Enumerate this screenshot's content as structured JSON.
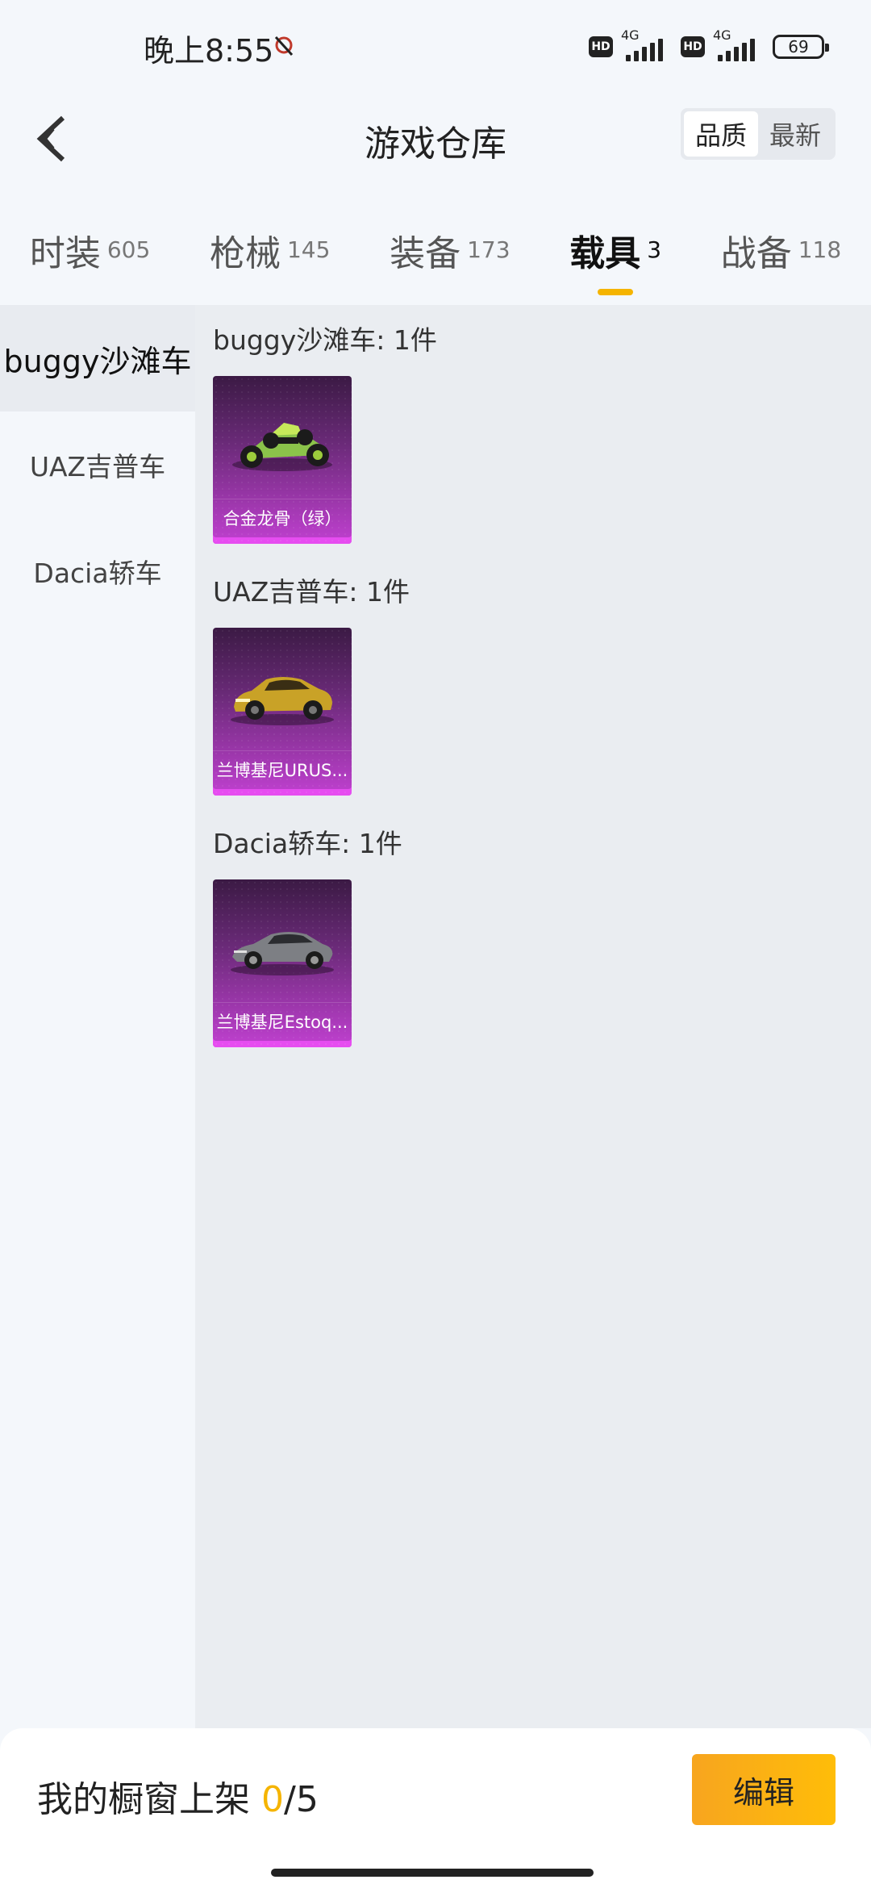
{
  "status_bar": {
    "time": "晚上8:55",
    "hd_1": "HD",
    "net_1": "4G",
    "hd_2": "HD",
    "net_2": "4G",
    "battery": "69"
  },
  "header": {
    "title": "游戏仓库",
    "sort_quality": "品质",
    "sort_latest": "最新",
    "sort_selected": "品质"
  },
  "tabs": [
    {
      "label": "时装",
      "count": "605"
    },
    {
      "label": "枪械",
      "count": "145"
    },
    {
      "label": "装备",
      "count": "173"
    },
    {
      "label": "载具",
      "count": "3"
    },
    {
      "label": "战备",
      "count": "118"
    }
  ],
  "active_tab": "载具",
  "sidebar": {
    "items": [
      {
        "label": "buggy沙滩车"
      },
      {
        "label": "UAZ吉普车"
      },
      {
        "label": "Dacia轿车"
      }
    ]
  },
  "groups": [
    {
      "title": "buggy沙滩车: 1件",
      "items": [
        {
          "name": "合金龙骨（绿）",
          "icon": "buggy-vehicle-icon"
        }
      ]
    },
    {
      "title": "UAZ吉普车: 1件",
      "items": [
        {
          "name": "兰博基尼URUS...",
          "icon": "suv-vehicle-icon"
        }
      ]
    },
    {
      "title": "Dacia轿车: 1件",
      "items": [
        {
          "name": "兰博基尼Estoq...",
          "icon": "sedan-vehicle-icon"
        }
      ]
    }
  ],
  "bottom_bar": {
    "label": "我的橱窗上架 ",
    "count": "0",
    "total": "/5",
    "edit_label": "编辑"
  },
  "colors": {
    "accent": "#f5b400",
    "card_purple": "#c040d0"
  }
}
